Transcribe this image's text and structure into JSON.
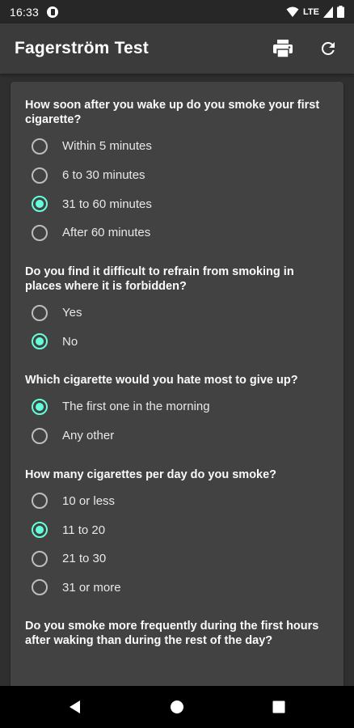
{
  "status_bar": {
    "time": "16:33",
    "network": "LTE"
  },
  "app_bar": {
    "title": "Fagerström Test"
  },
  "colors": {
    "accent": "#64ffda",
    "app_bar": "#3b3b3b",
    "card": "#424242",
    "background": "#2f2f2f"
  },
  "questions": [
    {
      "text": "How soon after you wake up do you smoke your first cigarette?",
      "options": [
        {
          "label": "Within 5 minutes",
          "checked": false
        },
        {
          "label": "6 to 30 minutes",
          "checked": false
        },
        {
          "label": "31 to 60 minutes",
          "checked": true
        },
        {
          "label": "After 60 minutes",
          "checked": false
        }
      ]
    },
    {
      "text": "Do you find it difficult to refrain from smoking in places where it is forbidden?",
      "options": [
        {
          "label": "Yes",
          "checked": false
        },
        {
          "label": "No",
          "checked": true
        }
      ]
    },
    {
      "text": "Which cigarette would you hate most to give up?",
      "options": [
        {
          "label": "The first one in the morning",
          "checked": true
        },
        {
          "label": "Any other",
          "checked": false
        }
      ]
    },
    {
      "text": "How many cigarettes per day do you smoke?",
      "options": [
        {
          "label": "10 or less",
          "checked": false
        },
        {
          "label": "11 to 20",
          "checked": true
        },
        {
          "label": "21 to 30",
          "checked": false
        },
        {
          "label": "31 or more",
          "checked": false
        }
      ]
    },
    {
      "text": "Do you smoke more frequently during the first hours after waking than during the rest of the day?",
      "options": []
    }
  ],
  "icons": {
    "print": "print-icon",
    "reset": "refresh-icon",
    "back": "back-icon",
    "home": "home-icon",
    "recents": "recents-icon"
  }
}
